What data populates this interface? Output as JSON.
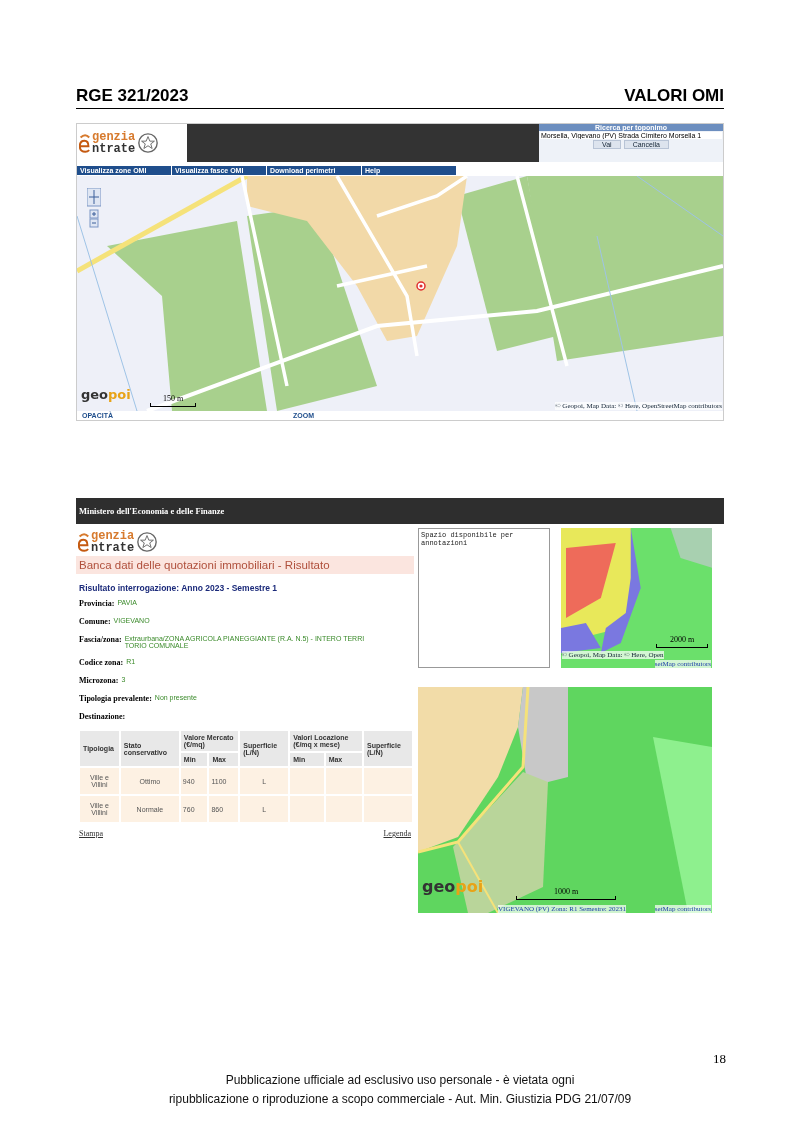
{
  "header": {
    "left": "RGE  321/2023",
    "right": "VALORI OMI"
  },
  "map_window": {
    "logo": {
      "line1": "genzia",
      "line2": "ntrate"
    },
    "search": {
      "title": "Ricerca per toponimo",
      "value": "Morsella, Vigevano (PV) Strada Cimitero Morsella 1",
      "buttons": [
        "Vai",
        "Cancella"
      ]
    },
    "nav": [
      "Visualizza zone OMI",
      "Visualizza fasce OMI",
      "Download perimetri",
      "Help"
    ],
    "map": {
      "scale": "150 m",
      "attribution": "© Geopoi, Map Data: © Here, OpenStreetMap contributors",
      "brand": {
        "part1": "geo",
        "part2": "poi"
      }
    },
    "bottom": [
      "OPACITÀ",
      "ZOOM"
    ]
  },
  "result_window": {
    "title": "Ministero dell'Economia e delle Finanze",
    "logo": {
      "line1": "genzia",
      "line2": "ntrate"
    },
    "heading": "Banca dati delle quotazioni immobiliari - Risultato",
    "subheading": "Risultato interrogazione: Anno 2023 - Semestre 1",
    "fields": [
      {
        "label": "Provincia:",
        "value": "PAVIA"
      },
      {
        "label": "Comune:",
        "value": "VIGEVANO"
      },
      {
        "label": "Fascia/zona:",
        "value": "Extraurbana/ZONA AGRICOLA PIANEGGIANTE (R.A. N.5) - INTERO TERRITORIO COMUNALE"
      },
      {
        "label": "Codice zona:",
        "value": "R1"
      },
      {
        "label": "Microzona:",
        "value": "3"
      },
      {
        "label": "Tipologia prevalente:",
        "value": "Non presente"
      },
      {
        "label": "Destinazione:"
      }
    ],
    "table": {
      "columns": [
        "Tipologia",
        "Stato conservativo",
        "Valore Mercato (€/mq)",
        "Superficie (L/N)",
        "Valori Locazione (€/mq x mese)",
        "Superficie (L/N)"
      ],
      "subcolumns": [
        "Min",
        "Max",
        "Min",
        "Max"
      ],
      "rows": [
        {
          "tipologia": "Ville e Villini",
          "stato": "Ottimo",
          "min": "940",
          "max": "1100",
          "superficie": "L"
        },
        {
          "tipologia": "Ville e Villini",
          "stato": "Normale",
          "min": "760",
          "max": "860",
          "superficie": "L"
        }
      ]
    },
    "links": [
      "Stampa",
      "Legenda"
    ],
    "notes": "Spazio disponibile per annotazioni",
    "small_map": {
      "scale": "2000 m",
      "attribution": "© Geopoi, Map Data: © Here, Open",
      "attribution_2": "setMap contributors"
    },
    "large_map": {
      "scale": "1000 m",
      "caption": "VIGEVANO (PV) Zona: R1 Semestre: 20231",
      "attribution": "setMap contributors",
      "brand": {
        "part1": "geo",
        "part2": "poi"
      }
    }
  },
  "page_number": "18",
  "footer": [
    "Pubblicazione ufficiale ad esclusivo uso personale - è vietata ogni",
    "ripubblicazione o riproduzione a scopo commerciale - Aut. Min. Giustizia PDG 21/07/09"
  ]
}
